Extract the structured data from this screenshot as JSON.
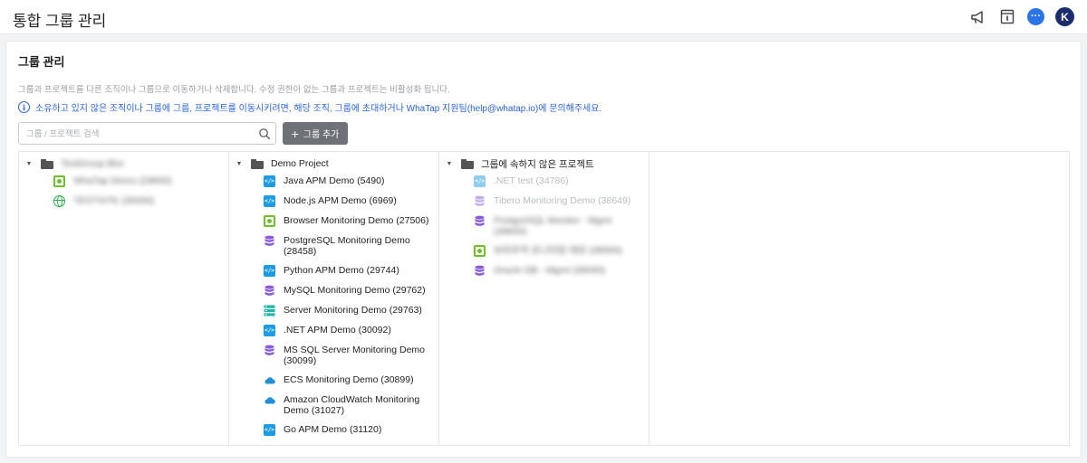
{
  "header": {
    "title": "통합 그룹 관리",
    "icons": [
      "megaphone-icon",
      "document-info-icon",
      "chat-icon",
      "user-avatar"
    ],
    "chat_badge": "···",
    "avatar_initial": "K"
  },
  "section": {
    "title": "그룹 관리",
    "description": "그룹과 프로젝트를 다른 조직이나 그룹으로 이동하거나 삭제합니다. 수정 권한이 없는 그룹과 프로젝트는 비활성화 됩니다.",
    "info_text": "소유하고 있지 않은 조직이나 그룹에 그룹, 프로젝트를 이동시키려면, 해당 조직, 그룹에 초대하거나 WhaTap 지원팀(help@whatap.io)에 문의해주세요."
  },
  "search": {
    "placeholder": "그룹 / 프로젝트 검색",
    "value": ""
  },
  "add_group_button": {
    "label": "그룹 추가"
  },
  "columns": [
    {
      "group_name": "TestGroup Blur",
      "blurred": true,
      "items": [
        {
          "icon": "browser",
          "label": "WhaTap Demo (29800)",
          "blurred": true
        },
        {
          "icon": "globe",
          "label": "TESTSITE (30000)",
          "blurred": true
        }
      ]
    },
    {
      "group_name": "Demo Project",
      "items": [
        {
          "icon": "code",
          "label": "Java APM Demo (5490)"
        },
        {
          "icon": "code",
          "label": "Node.js APM Demo (6969)"
        },
        {
          "icon": "browser",
          "label": "Browser Monitoring Demo (27506)"
        },
        {
          "icon": "db",
          "label": "PostgreSQL Monitoring Demo (28458)"
        },
        {
          "icon": "code",
          "label": "Python APM Demo (29744)"
        },
        {
          "icon": "db",
          "label": "MySQL Monitoring Demo (29762)"
        },
        {
          "icon": "server",
          "label": "Server Monitoring Demo (29763)"
        },
        {
          "icon": "code",
          "label": ".NET APM Demo (30092)"
        },
        {
          "icon": "db",
          "label": "MS SQL Server Monitoring Demo (30099)"
        },
        {
          "icon": "cloud",
          "label": "ECS Monitoring Demo (30899)"
        },
        {
          "icon": "cloud",
          "label": "Amazon CloudWatch Monitoring Demo (31027)"
        },
        {
          "icon": "code",
          "label": "Go APM Demo (31120)"
        }
      ]
    },
    {
      "group_name": "그룹에 속하지 않은 프로젝트",
      "items": [
        {
          "icon": "code",
          "label": ".NET test (34786)",
          "dim": true
        },
        {
          "icon": "db",
          "label": "Tibero Monitoring Demo (38649)",
          "dim": true
        },
        {
          "icon": "db",
          "label": "PostgreSQL Monitor - Mgmt (38800)",
          "blurred": true
        },
        {
          "icon": "browser",
          "label": "브라우저 모니터링 데모 (38900)",
          "blurred": true
        },
        {
          "icon": "db",
          "label": "Oracle DB - Mgmt (39000)",
          "blurred": true
        }
      ]
    }
  ],
  "colors": {
    "accent_blue": "#2a63d8",
    "code_icon": "#1d9be3",
    "browser_icon": "#6fbf2a",
    "db_icon": "#8a5bd6",
    "server_icon": "#22b5a3",
    "cloud_icon": "#1f8fd6",
    "globe_icon": "#2fae4b",
    "button_bg": "#6e7177"
  }
}
